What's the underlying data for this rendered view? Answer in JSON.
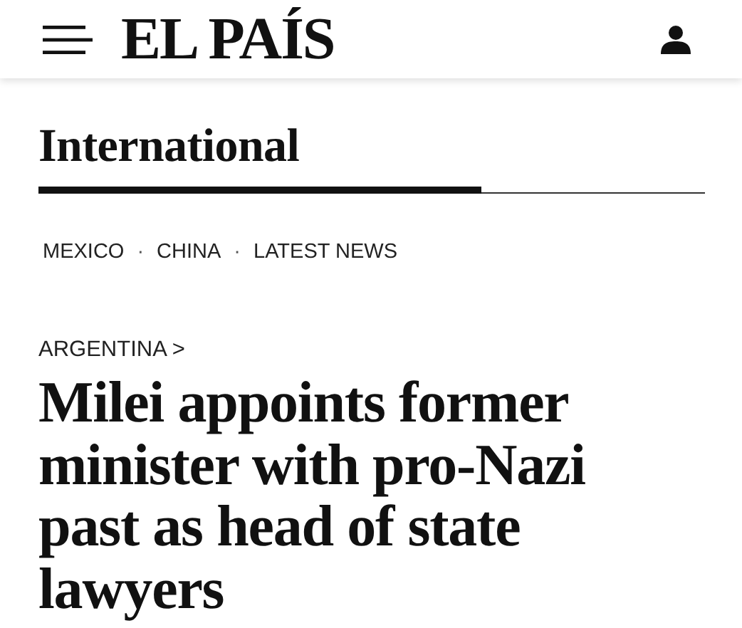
{
  "header": {
    "logo": "EL PAÍS"
  },
  "section": {
    "title": "International"
  },
  "nav": [
    {
      "kind": "link",
      "label": "MEXICO"
    },
    {
      "kind": "separator",
      "label": "·"
    },
    {
      "kind": "link",
      "label": "CHINA"
    },
    {
      "kind": "separator",
      "label": "·"
    },
    {
      "kind": "link",
      "label": "LATEST NEWS"
    }
  ],
  "article": {
    "kicker": "ARGENTINA >",
    "headline": "Milei appoints former minister with pro-Nazi past as head of state lawyers"
  }
}
